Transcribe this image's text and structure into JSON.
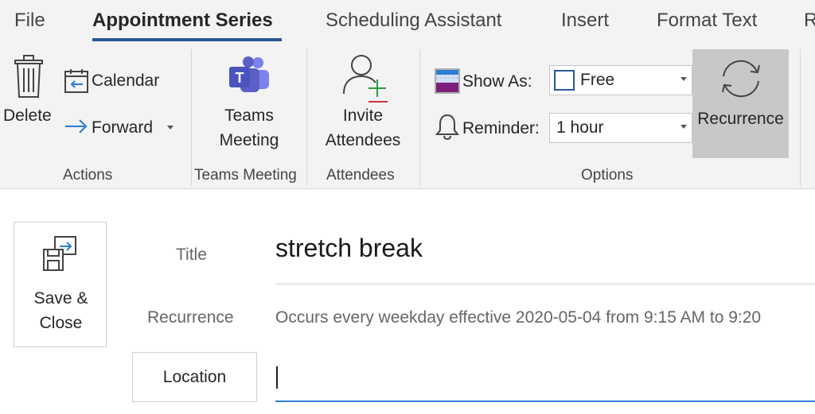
{
  "tabs": [
    {
      "label": "File"
    },
    {
      "label": "Appointment Series"
    },
    {
      "label": "Scheduling Assistant"
    },
    {
      "label": "Insert"
    },
    {
      "label": "Format Text"
    },
    {
      "label": "R"
    }
  ],
  "ribbon": {
    "actions": {
      "delete_label": "Delete",
      "calendar_label": "Calendar",
      "forward_label": "Forward",
      "group_label": "Actions"
    },
    "teams": {
      "button_line1": "Teams",
      "button_line2": "Meeting",
      "group_label": "Teams Meeting"
    },
    "attendees": {
      "button_line1": "Invite",
      "button_line2": "Attendees",
      "group_label": "Attendees"
    },
    "options": {
      "show_as_label": "Show As:",
      "show_as_value": "Free",
      "reminder_label": "Reminder:",
      "reminder_value": "1 hour",
      "recurrence_label": "Recurrence",
      "group_label": "Options"
    }
  },
  "form": {
    "save_close_line1": "Save &",
    "save_close_line2": "Close",
    "title_label": "Title",
    "title_value": "stretch break",
    "recurrence_label": "Recurrence",
    "recurrence_value": "Occurs every weekday effective 2020-05-04 from 9:15 AM to 9:20",
    "location_label": "Location",
    "location_value": ""
  },
  "colors": {
    "accent": "#2b5797",
    "ribbon_bg": "#f3f3f3",
    "recurrence_pressed": "#c8c8c8",
    "teams_purple": "#5b5fc7",
    "invite_plus": "#2e9b3e",
    "invite_minus": "#d13438",
    "show_as_purple": "#7a1f7a",
    "input_focus": "#2b7cd3"
  },
  "icons": [
    "trash-icon",
    "calendar-icon",
    "forward-arrow-icon",
    "teams-icon",
    "invite-attendees-icon",
    "show-as-icon",
    "bell-icon",
    "recurrence-icon",
    "save-close-icon"
  ]
}
